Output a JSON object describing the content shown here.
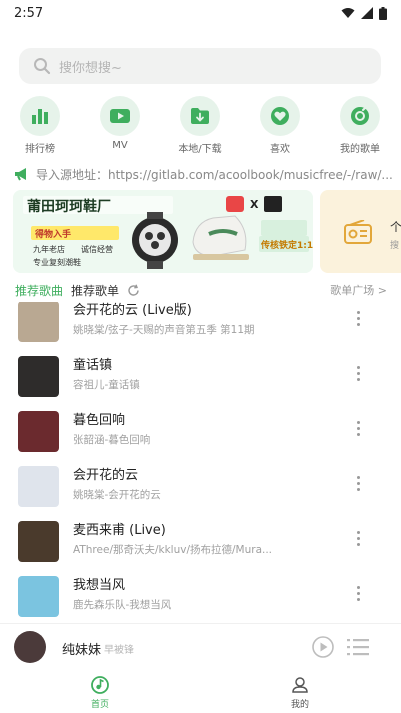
{
  "status": {
    "time": "2:57"
  },
  "search": {
    "placeholder": "搜你想搜~"
  },
  "quick_actions": [
    {
      "label": "排行榜",
      "icon": "bar-chart-icon"
    },
    {
      "label": "MV",
      "icon": "video-icon"
    },
    {
      "label": "本地/下载",
      "icon": "download-folder-icon"
    },
    {
      "label": "喜欢",
      "icon": "heart-icon"
    },
    {
      "label": "我的歌单",
      "icon": "playlist-icon"
    }
  ],
  "source_notice": {
    "text": "导入源地址：https://gitlab.com/acoolbook/musicfree/-/raw/..."
  },
  "banner": {
    "title": "莆田珂珂鞋厂",
    "collab_mark": "X",
    "line1": "九年老店",
    "line2": "诚信经营",
    "line3": "专业复刻潮鞋",
    "badge": "得物入手",
    "promo": "传核铁定1:1"
  },
  "banner2": {
    "text": "个",
    "sub": "搜"
  },
  "tabs": {
    "recommend_songs": "推荐歌曲",
    "recommend_playlists": "推荐歌单",
    "plaza": "歌单广场 >"
  },
  "songs": [
    {
      "title": "会开花的云 (Live版)",
      "subtitle": "姚晓棠/弦子-天赐的声音第五季 第11期",
      "cover_color": "#b9a892"
    },
    {
      "title": "童话镇",
      "subtitle": "容祖儿-童话镇",
      "cover_color": "#2e2c2b"
    },
    {
      "title": "暮色回响",
      "subtitle": "张韶涵-暮色回响",
      "cover_color": "#6b2a2e"
    },
    {
      "title": "会开花的云",
      "subtitle": "姚晓棠-会开花的云",
      "cover_color": "#dfe4ec"
    },
    {
      "title": "麦西来甫 (Live)",
      "subtitle": "AThree/那奇沃夫/kkluv/扬布拉德/Mura...",
      "cover_color": "#4a3a2c"
    },
    {
      "title": "我想当风",
      "subtitle": "鹿先森乐队-我想当风",
      "cover_color": "#7bc4e0"
    }
  ],
  "player": {
    "title": "纯妹妹",
    "artist": "早被锋"
  },
  "nav": {
    "home": "首页",
    "mine": "我的"
  },
  "colors": {
    "accent": "#3fae5e",
    "accent_light": "#e6f3ea"
  }
}
